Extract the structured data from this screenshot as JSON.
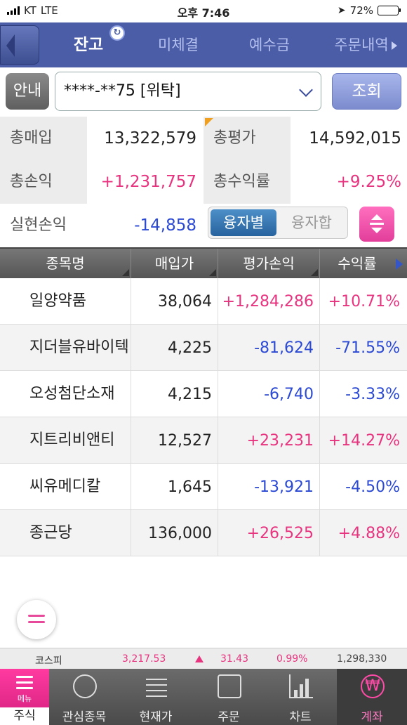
{
  "status": {
    "carrier": "KT",
    "network": "LTE",
    "time": "오후 7:46",
    "battery": "72%",
    "battery_level": 0.72
  },
  "tabs": [
    {
      "label": "잔고",
      "active": true
    },
    {
      "label": "미체결",
      "active": false
    },
    {
      "label": "예수금",
      "active": false
    },
    {
      "label": "주문내역",
      "active": false
    }
  ],
  "account": {
    "guide_label": "안내",
    "number": "****-**75 [위탁]",
    "query_label": "조회"
  },
  "summary": {
    "total_buy_label": "총매입",
    "total_buy": "13,322,579",
    "total_eval_label": "총평가",
    "total_eval": "14,592,015",
    "total_pl_label": "총손익",
    "total_pl": "+1,231,757",
    "total_rate_label": "총수익률",
    "total_rate": "+9.25%",
    "realized_label": "실현손익",
    "realized": "-14,858",
    "toggle_on": "융자별",
    "toggle_off": "융자합"
  },
  "table": {
    "headers": [
      "종목명",
      "매입가",
      "평가손익",
      "수익률"
    ],
    "rows": [
      {
        "name": "일양약품",
        "price": "38,064",
        "pl": "+1,284,286",
        "rate": "+10.71%",
        "sign": "pos"
      },
      {
        "name": "지더블유바이텍",
        "price": "4,225",
        "pl": "-81,624",
        "rate": "-71.55%",
        "sign": "neg"
      },
      {
        "name": "오성첨단소재",
        "price": "4,215",
        "pl": "-6,740",
        "rate": "-3.33%",
        "sign": "neg"
      },
      {
        "name": "지트리비앤티",
        "price": "12,527",
        "pl": "+23,231",
        "rate": "+14.27%",
        "sign": "pos"
      },
      {
        "name": "씨유메디칼",
        "price": "1,645",
        "pl": "-13,921",
        "rate": "-4.50%",
        "sign": "neg"
      },
      {
        "name": "종근당",
        "price": "136,000",
        "pl": "+26,525",
        "rate": "+4.88%",
        "sign": "pos"
      }
    ]
  },
  "ticker": {
    "name": "코스피",
    "index": "3,217.53",
    "change": "31.43",
    "percent": "0.99%",
    "volume": "1,298,330"
  },
  "bottom_nav": {
    "menu_small": "메뉴",
    "menu_label": "주식",
    "items": [
      {
        "label": "관심종목",
        "icon": "star-circle-icon"
      },
      {
        "label": "현재가",
        "icon": "price-lines-icon"
      },
      {
        "label": "주문",
        "icon": "swap-icon"
      },
      {
        "label": "차트",
        "icon": "chart-icon"
      },
      {
        "label": "계좌",
        "icon": "won-icon",
        "active": true
      }
    ]
  },
  "colors": {
    "tab_bar": "#4b5da6",
    "positive": "#e8337f",
    "negative": "#2b49d3",
    "accent": "#e23e9a"
  }
}
